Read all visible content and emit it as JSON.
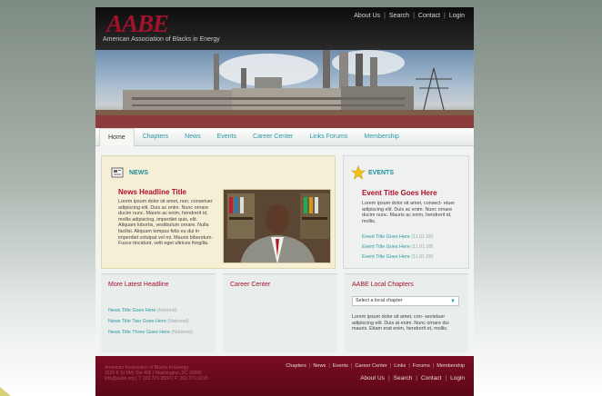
{
  "header": {
    "logo": "AABE",
    "org_name": "American Association of Blacks in Energy",
    "top_links": [
      "About Us",
      "Search",
      "Contact",
      "Login"
    ]
  },
  "nav": {
    "items": [
      "Home",
      "Chapters",
      "News",
      "Events",
      "Career Center",
      "Links Forums",
      "Membership"
    ],
    "active": "Home"
  },
  "news": {
    "label": "NEWS",
    "headline": "News Headline Title",
    "body": "Lorem ipsum dolor sit amet, non. consetuer adipiscing elit. Duis ac enim. Nunc ornare ducim nunc. Mauris ac enim, hendrerit id, mollis adipiscing, imperdiet quis, elit. Aliquam lobortis, vestibulum ornare. Nulla facilisi. Aliquam tempus felis eu dui in imperdiet volutpat vel mi. Mauris bibendum. Fusce tincidunt, velit eget ultrices fringilla."
  },
  "events": {
    "label": "EVENTS",
    "title": "Event Title Goes Here",
    "body": "Lorem ipsum dolor sit amet, consect- etuer adipiscing elit. Duis ac enim. Nunc ornare ducim nunc. Mauris ac enim, hendrerit id, mollis.",
    "list": [
      {
        "title": "Event Title Goes Here",
        "date": "(11.01.09)"
      },
      {
        "title": "Event Title Goes Here",
        "date": "(11.01.09)"
      },
      {
        "title": "Event Title Goes Here",
        "date": "(11.01.09)"
      }
    ]
  },
  "latest": {
    "title": "More Latest Headline",
    "items": [
      {
        "title": "News Title Goes Here",
        "source": "(Internal)"
      },
      {
        "title": "News Title Two Goes Here",
        "source": "(National)"
      },
      {
        "title": "News Title Three Goes Here",
        "source": "(National)"
      }
    ]
  },
  "career": {
    "title": "Career Center"
  },
  "chapters": {
    "title": "AABE Local Chapters",
    "select_value": "Select a local chapter",
    "body": "Lorem ipsum dolor sit amet, con- sectetuer adipiscing elit. Duis at enim. Nunc ornare dui mauris. Etiam erat enim, hendrerit et, mollis."
  },
  "footer": {
    "info": [
      "American Association of Blacks in Energy",
      "1625 K St NW, Ste 405 | Washington, DC 20006",
      "info@aabe.org | T: 202.371.9530 | F: 202.371.9218"
    ],
    "links": [
      "Chapters",
      "News",
      "Events",
      "Career Center",
      "Links",
      "Forums",
      "Membership"
    ],
    "links2": [
      "About Us",
      "Search",
      "Contact",
      "Login"
    ]
  },
  "colors": {
    "brand_red": "#a3122c",
    "accent_teal": "#2a98a4",
    "footer": "#6b0a1d"
  }
}
